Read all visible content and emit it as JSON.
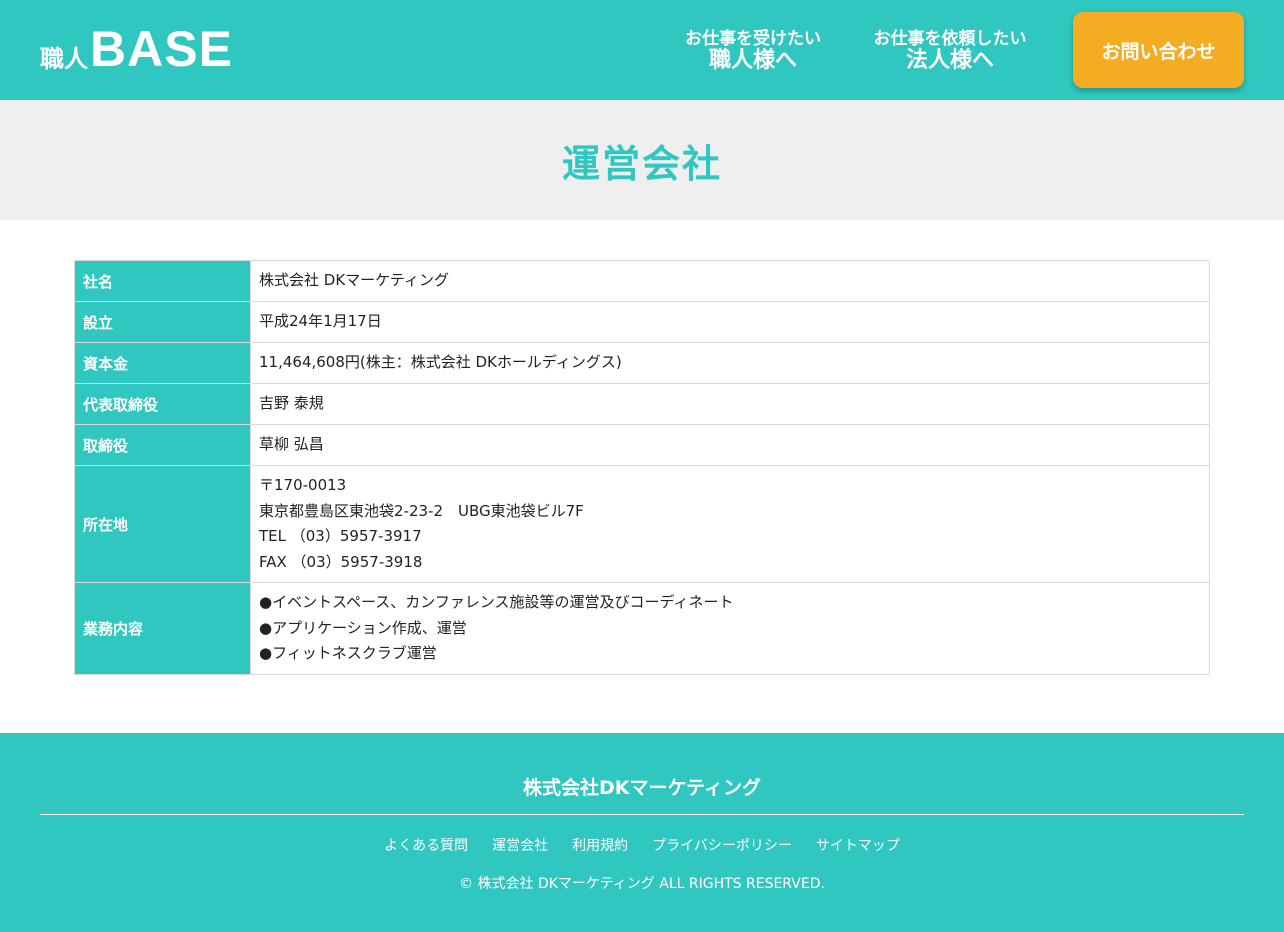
{
  "header": {
    "logo_ja": "職人",
    "logo_en": "BASE",
    "nav_worker_small": "お仕事を受けたい",
    "nav_worker_big": "職人様へ",
    "nav_client_small": "お仕事を依頼したい",
    "nav_client_big": "法人様へ",
    "contact_label": "お問い合わせ"
  },
  "hero": {
    "title": "運営会社"
  },
  "company": {
    "rows": [
      {
        "label": "社名",
        "lines": [
          "株式会社 DKマーケティング"
        ]
      },
      {
        "label": "設立",
        "lines": [
          "平成24年1月17日"
        ]
      },
      {
        "label": "資本金",
        "lines": [
          "11,464,608円(株主：株式会社 DKホールディングス)"
        ]
      },
      {
        "label": "代表取締役",
        "lines": [
          "吉野 泰規"
        ]
      },
      {
        "label": "取締役",
        "lines": [
          "草柳 弘昌"
        ]
      },
      {
        "label": "所在地",
        "lines": [
          "〒170-0013",
          "東京都豊島区東池袋2-23-2　UBG東池袋ビル7F",
          "TEL （03）5957-3917",
          "FAX （03）5957-3918"
        ]
      },
      {
        "label": "業務内容",
        "lines": [
          "●イベントスペース、カンファレンス施設等の運営及びコーディネート",
          "●アプリケーション作成、運営",
          "●フィットネスクラブ運営"
        ]
      }
    ]
  },
  "footer": {
    "company_name": "株式会社DKマーケティング",
    "links": [
      "よくある質問",
      "運営会社",
      "利用規約",
      "プライバシーポリシー",
      "サイトマップ"
    ],
    "copyright": "© 株式会社 DKマーケティング ALL RIGHTS RESERVED."
  },
  "colors": {
    "brand_teal": "#2fc7bf",
    "accent_orange": "#f4ac23",
    "hero_bg": "#efefef"
  }
}
